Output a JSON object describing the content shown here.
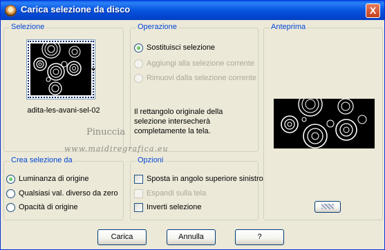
{
  "window": {
    "title": "Carica selezione da disco",
    "close_label": "X"
  },
  "selezione": {
    "title": "Selezione",
    "file_name": "adita-les-avani-sel-02"
  },
  "operazione": {
    "title": "Operazione",
    "options": [
      {
        "label": "Sostituisci selezione",
        "checked": true,
        "enabled": true
      },
      {
        "label": "Aggiungi alla selezione corrente",
        "checked": false,
        "enabled": false
      },
      {
        "label": "Rimuovi dalla selezione corrente",
        "checked": false,
        "enabled": false
      }
    ],
    "description": "Il rettangolo originale della selezione intersecherà completamente la tela."
  },
  "anteprima": {
    "title": "Anteprima"
  },
  "crea_selezione": {
    "title": "Crea selezione da",
    "options": [
      {
        "label": "Luminanza di origine",
        "checked": true
      },
      {
        "label": "Qualsiasi val. diverso da zero",
        "checked": false
      },
      {
        "label": "Opacità di origine",
        "checked": false
      }
    ]
  },
  "opzioni": {
    "title": "Opzioni",
    "options": [
      {
        "label": "Sposta in angolo superiore sinistro",
        "checked": false,
        "enabled": true
      },
      {
        "label": "Espandi sulla tela",
        "checked": false,
        "enabled": false
      },
      {
        "label": "Inverti selezione",
        "checked": false,
        "enabled": true
      }
    ]
  },
  "watermark": {
    "line1": "Pinuccia",
    "line2": "www.maidiregrafica.eu"
  },
  "buttons": {
    "carica": "Carica",
    "annulla": "Annulla",
    "help": "?"
  }
}
